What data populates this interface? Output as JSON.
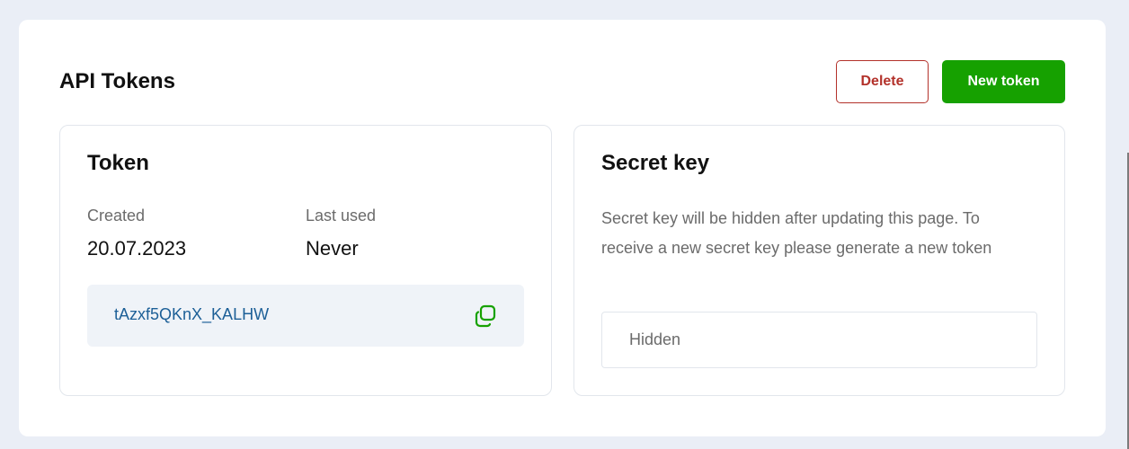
{
  "header": {
    "title": "API Tokens",
    "delete_label": "Delete",
    "new_token_label": "New token"
  },
  "token_card": {
    "title": "Token",
    "created_label": "Created",
    "created_value": "20.07.2023",
    "last_used_label": "Last used",
    "last_used_value": "Never",
    "token_value": "tAzxf5QKnX_KALHW",
    "copy_icon": "copy-icon"
  },
  "secret_card": {
    "title": "Secret key",
    "description": "Secret key will be hidden after updating this page. To receive a new secret key please generate a new token",
    "input_placeholder": "Hidden"
  },
  "colors": {
    "background": "#eaeef6",
    "accent_green": "#16a100",
    "danger_red": "#b3322b",
    "token_link": "#1c5f97"
  }
}
